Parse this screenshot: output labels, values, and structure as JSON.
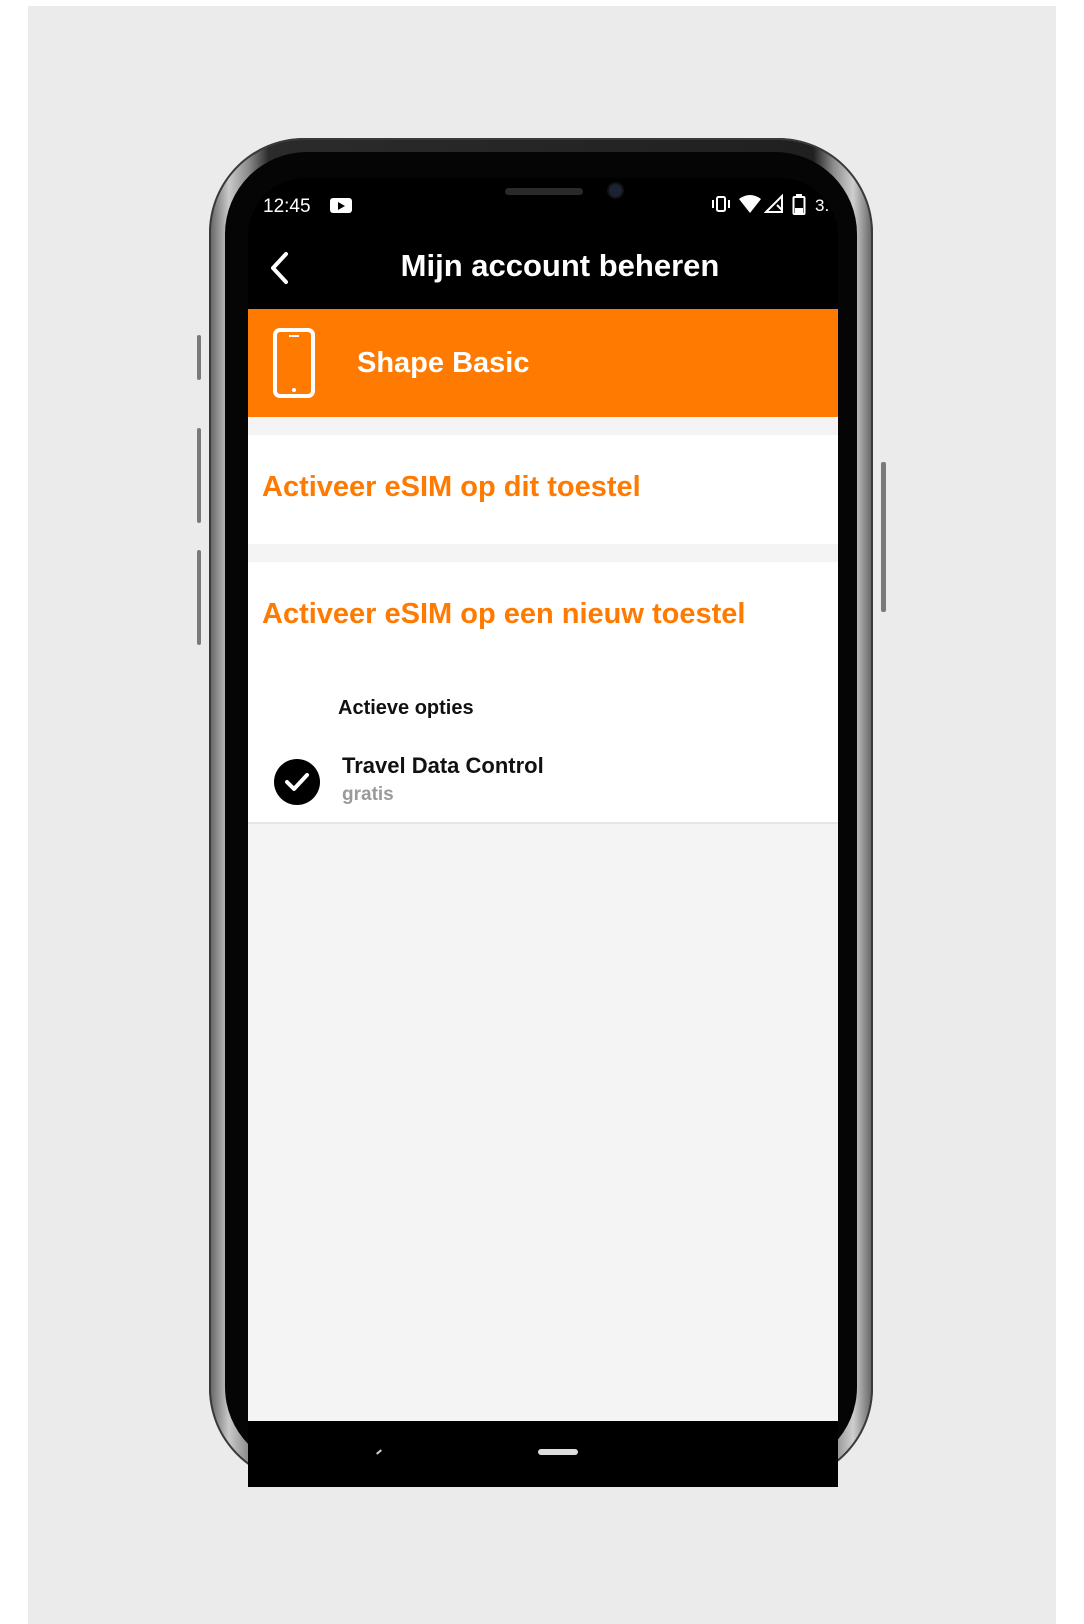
{
  "status_bar": {
    "time": "12:45",
    "battery_text": "3."
  },
  "header": {
    "back_icon": "chevron-left-icon",
    "title": "Mijn account beheren"
  },
  "plan": {
    "icon": "smartphone-icon",
    "name": "Shape Basic"
  },
  "actions": {
    "activate_this_device": "Activeer eSIM op dit toestel",
    "activate_new_device": "Activeer eSIM op een nieuw toestel"
  },
  "active_options": {
    "heading": "Actieve opties",
    "items": [
      {
        "icon": "check-circle-icon",
        "name": "Travel Data Control",
        "price": "gratis"
      }
    ]
  },
  "colors": {
    "accent": "#ff7a00",
    "background": "#f4f4f4"
  }
}
